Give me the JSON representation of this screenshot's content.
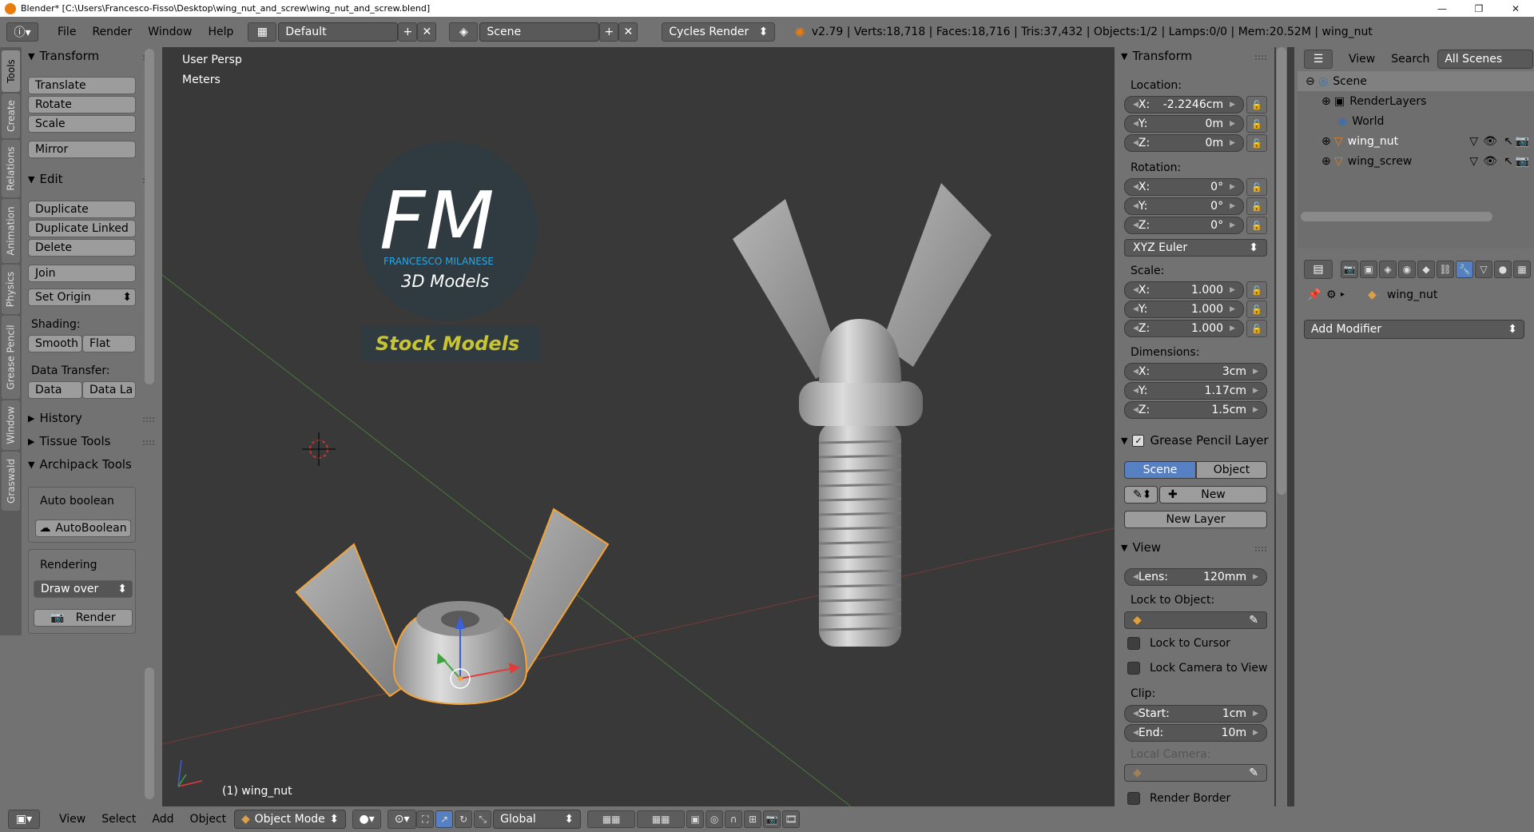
{
  "window": {
    "title": "Blender* [C:\\Users\\Francesco-Fisso\\Desktop\\wing_nut_and_screw\\wing_nut_and_screw.blend]",
    "minimize": "—",
    "maximize": "❐",
    "close": "✕"
  },
  "infobar": {
    "menus": [
      "File",
      "Render",
      "Window",
      "Help"
    ],
    "layout": "Default",
    "scene": "Scene",
    "engine": "Cycles Render",
    "stats": "v2.79 | Verts:18,718 | Faces:18,716 | Tris:37,432 | Objects:1/2 | Lamps:0/0 | Mem:20.52M | wing_nut"
  },
  "tooltabs": [
    "Tools",
    "Create",
    "Relations",
    "Animation",
    "Physics",
    "Grease Pencil",
    "Window",
    "Graswald"
  ],
  "toolshelf": {
    "transform": {
      "title": "Transform",
      "buttons": [
        "Translate",
        "Rotate",
        "Scale",
        "Mirror"
      ]
    },
    "edit": {
      "title": "Edit",
      "buttons": [
        "Duplicate",
        "Duplicate Linked",
        "Delete",
        "Join",
        "Set Origin"
      ],
      "shading_label": "Shading:",
      "smooth": "Smooth",
      "flat": "Flat",
      "data_transfer_label": "Data Transfer:",
      "data": "Data",
      "data_la": "Data La"
    },
    "history": "History",
    "tissue": "Tissue Tools",
    "archipack": {
      "title": "Archipack Tools",
      "auto_boolean_label": "Auto boolean",
      "auto_boolean_btn": "AutoBoolean",
      "rendering_label": "Rendering",
      "draw_over": "Draw over",
      "render_btn": "Render"
    }
  },
  "viewport": {
    "view_name": "User Persp",
    "units": "Meters",
    "object_label": "(1) wing_nut",
    "logo": {
      "letters": "FM",
      "name": "FRANCESCO MILANESE",
      "sub": "3D Models",
      "tag": "Stock Models"
    }
  },
  "npanel": {
    "transform_title": "Transform",
    "location_label": "Location:",
    "location": [
      {
        "axis": "X:",
        "value": "-2.2246cm"
      },
      {
        "axis": "Y:",
        "value": "0m"
      },
      {
        "axis": "Z:",
        "value": "0m"
      }
    ],
    "rotation_label": "Rotation:",
    "rotation": [
      {
        "axis": "X:",
        "value": "0°"
      },
      {
        "axis": "Y:",
        "value": "0°"
      },
      {
        "axis": "Z:",
        "value": "0°"
      }
    ],
    "rotation_mode": "XYZ Euler",
    "scale_label": "Scale:",
    "scale": [
      {
        "axis": "X:",
        "value": "1.000"
      },
      {
        "axis": "Y:",
        "value": "1.000"
      },
      {
        "axis": "Z:",
        "value": "1.000"
      }
    ],
    "dimensions_label": "Dimensions:",
    "dimensions": [
      {
        "axis": "X:",
        "value": "3cm"
      },
      {
        "axis": "Y:",
        "value": "1.17cm"
      },
      {
        "axis": "Z:",
        "value": "1.5cm"
      }
    ],
    "gp_title": "Grease Pencil Layer",
    "gp_scene": "Scene",
    "gp_object": "Object",
    "gp_new": "New",
    "gp_new_layer": "New Layer",
    "view_title": "View",
    "lens_label": "Lens:",
    "lens_value": "120mm",
    "lock_to_object": "Lock to Object:",
    "lock_to_cursor": "Lock to Cursor",
    "lock_camera": "Lock Camera to View",
    "clip_label": "Clip:",
    "clip_start_label": "Start:",
    "clip_start": "1cm",
    "clip_end_label": "End:",
    "clip_end": "10m",
    "local_camera": "Local Camera:",
    "render_border": "Render Border"
  },
  "outliner": {
    "view": "View",
    "search": "Search",
    "all_scenes": "All Scenes",
    "rows": [
      "Scene",
      "RenderLayers",
      "World",
      "wing_nut",
      "wing_screw"
    ]
  },
  "properties": {
    "object_name": "wing_nut",
    "add_modifier": "Add Modifier"
  },
  "bottombar": {
    "menus": [
      "View",
      "Select",
      "Add",
      "Object"
    ],
    "mode": "Object Mode",
    "orientation": "Global"
  },
  "colors": {
    "panel": "#727272",
    "viewport": "#393939",
    "accent": "#5680c2",
    "selection": "#f1a33c"
  }
}
